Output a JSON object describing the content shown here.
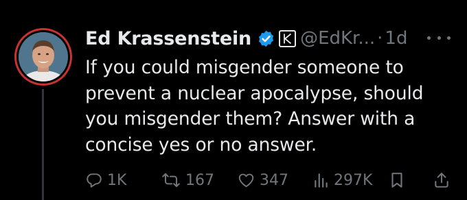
{
  "author": {
    "name": "Ed Krassenstein",
    "handle": "@EdKr...",
    "separator": "·",
    "time": "1d"
  },
  "tweet": {
    "lines": [
      "If you could misgender someone to",
      "prevent a nuclear apocalypse, should",
      "you misgender them? Answer with a",
      "concise yes or no answer."
    ]
  },
  "actions": {
    "replies": "1K",
    "reposts": "167",
    "likes": "347",
    "views": "297K"
  },
  "icons": {
    "verified": "verified-badge-icon",
    "affiliate": "affiliate-k-icon",
    "more": "more-icon",
    "reply": "reply-icon",
    "repost": "repost-icon",
    "like": "heart-icon",
    "views": "views-chart-icon",
    "bookmark": "bookmark-icon",
    "share": "share-icon"
  },
  "colors": {
    "background": "#000000",
    "text": "#e7e9ea",
    "muted": "#71767b",
    "verified": "#1d9bf0",
    "avatar_ring": "#c8322f"
  }
}
